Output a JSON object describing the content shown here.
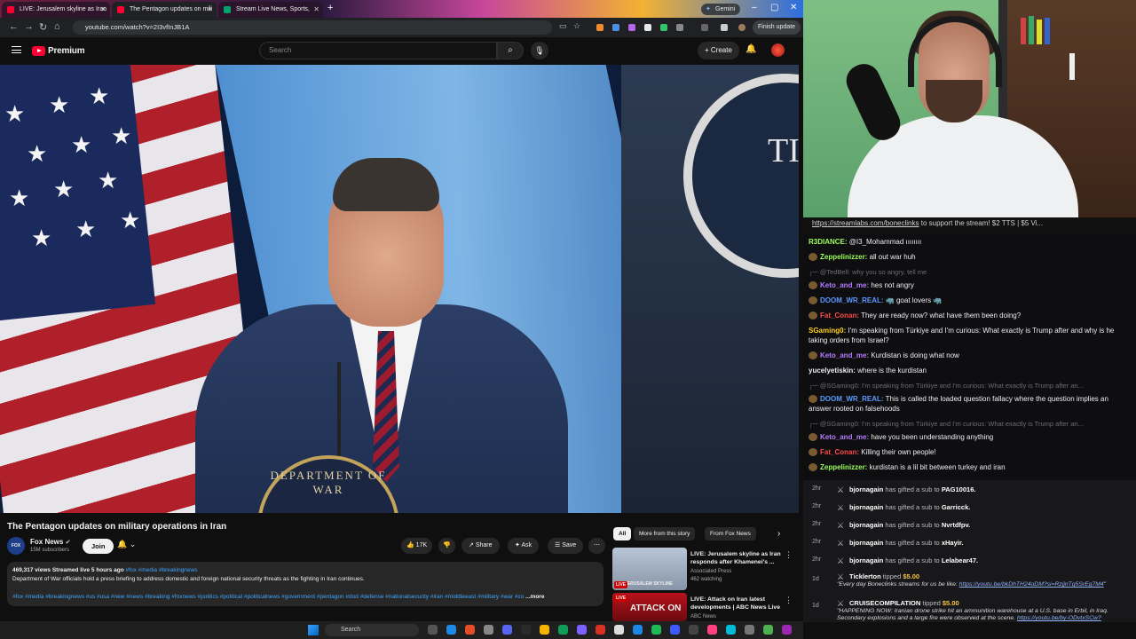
{
  "browser": {
    "tabs": [
      {
        "label": "LIVE: Jerusalem skyline as Iran",
        "active": false
      },
      {
        "label": "The Pentagon updates on mili",
        "active": true
      },
      {
        "label": "Stream Live News, Sports,",
        "active": false
      }
    ],
    "gemini_label": "Gemini",
    "url": "youtube.com/watch?v=2I3vfInJB1A",
    "finish_update": "Finish update"
  },
  "youtube": {
    "logo_text": "Premium",
    "search_placeholder": "Search",
    "create_label": "Create"
  },
  "video": {
    "podium_text": "DEPARTMENT OF WAR",
    "wall_letter": "TI",
    "title": "The Pentagon updates on military operations in Iran"
  },
  "channel": {
    "name": "Fox News",
    "subscribers": "15M subscribers",
    "join_label": "Join"
  },
  "actions": {
    "likes": "17K",
    "share": "Share",
    "ask": "Ask",
    "save": "Save"
  },
  "description": {
    "meta": "469,317 views  Streamed live 5 hours ago",
    "meta_tags": "#fox #media #breakingnews",
    "text": "Department of War officials hold a press briefing to address domestic and foreign national security threats as the fighting in Iran continues.",
    "tags": "#fox #media #breakingnews #us #usa #new #news #breaking #foxnews #politics #political #politicalnews #government #pentagon #dod #defense #nationalsecurity #iran #middleeast #military #war #co",
    "more": "...more"
  },
  "related": {
    "chips": [
      "All",
      "More from this story",
      "From Fox News"
    ],
    "items": [
      {
        "title": "LIVE: Jerusalem skyline as Iran responds after Khamenei's ...",
        "channel": "Associated Press",
        "meta": "462 watching",
        "thumb_text": "JERUSALEM SKYLINE",
        "badge": "LIVE"
      },
      {
        "title": "LIVE: Attack on Iran latest developments | ABC News Live",
        "channel": "ABC News",
        "meta": "",
        "thumb_text": "ATTACK ON",
        "badge": "LIVE"
      }
    ]
  },
  "stream": {
    "banner_link": "https://streamlabs.com/boneclinks",
    "banner_rest": " to support the stream! $2 TTS | $5 Vi..."
  },
  "chat": [
    {
      "user": "R3DIANCE:",
      "color": "#9cff5c",
      "text": " @I3_Mohammad ıııııııı",
      "badge": false,
      "reply": false
    },
    {
      "user": "Zeppelinizzer:",
      "color": "#9cff5c",
      "text": " all out war huh",
      "badge": true,
      "reply": false
    },
    {
      "user": "",
      "color": "#6d6d72",
      "text": "@TedBell: why you so angry, tell me",
      "badge": false,
      "reply": true
    },
    {
      "user": "Keto_and_me:",
      "color": "#b57bff",
      "text": " hes not angry",
      "badge": true,
      "reply": false
    },
    {
      "user": "DOOM_WR_REAL:",
      "color": "#5b9bff",
      "text": " 🦏 goat lovers 🦏",
      "badge": true,
      "reply": false
    },
    {
      "user": "Fat_Conan:",
      "color": "#ff4a4a",
      "text": " They are ready now? what have them been doing?",
      "badge": true,
      "reply": false
    },
    {
      "user": "SGaming0:",
      "color": "#ffd21f",
      "text": " I'm speaking from Türkiye and I'm curious: What exactly is Trump after and why is he taking orders from Israel?",
      "badge": false,
      "reply": false
    },
    {
      "user": "Keto_and_me:",
      "color": "#b57bff",
      "text": " Kurdistan is doing what now",
      "badge": true,
      "reply": false
    },
    {
      "user": "yucelyetiskin:",
      "color": "#efeff1",
      "text": " where is the kurdistan",
      "badge": false,
      "reply": false
    },
    {
      "user": "",
      "color": "#6d6d72",
      "text": "@SGaming0: I'm speaking from Türkiye and I'm curious: What exactly is Trump after an...",
      "badge": false,
      "reply": true
    },
    {
      "user": "DOOM_WR_REAL:",
      "color": "#5b9bff",
      "text": " This is called the loaded question fallacy where the question implies an answer rooted on falsehoods",
      "badge": true,
      "reply": false
    },
    {
      "user": "",
      "color": "#6d6d72",
      "text": "@SGaming0: I'm speaking from Türkiye and I'm curious: What exactly is Trump after an...",
      "badge": false,
      "reply": true
    },
    {
      "user": "Keto_and_me:",
      "color": "#b57bff",
      "text": " have you been understanding anything",
      "badge": true,
      "reply": false
    },
    {
      "user": "Fat_Conan:",
      "color": "#ff4a4a",
      "text": " Killing their own people!",
      "badge": true,
      "reply": false
    },
    {
      "user": "Zeppelinizzer:",
      "color": "#9cff5c",
      "text": " kurdistan is a lil bit between turkey and iran",
      "badge": true,
      "reply": false
    }
  ],
  "events": [
    {
      "time": "2hr",
      "user": "bjornagain",
      "action": " has gifted a sub to ",
      "target": "PAG10016."
    },
    {
      "time": "2hr",
      "user": "bjornagain",
      "action": " has gifted a sub to ",
      "target": "Garricck."
    },
    {
      "time": "2hr",
      "user": "bjornagain",
      "action": " has gifted a sub to ",
      "target": "Nvrtdfpv."
    },
    {
      "time": "2hr",
      "user": "bjornagain",
      "action": " has gifted a sub to ",
      "target": "xHayir."
    },
    {
      "time": "2hr",
      "user": "bjornagain",
      "action": " has gifted a sub to ",
      "target": "Lelabear47."
    }
  ],
  "tips": [
    {
      "time": "1d",
      "user": "Ticklerton",
      "action": " tipped ",
      "amount": "$5.00",
      "message": "\"Every day Boneclinks streams for us be like: ",
      "link": "https://youtu.be/bkDhTH24oDM?si=RzjjnTg5SrEg7M4",
      "end": "\""
    },
    {
      "time": "1d",
      "user": "CRUISECOMPILATION",
      "action": " tipped ",
      "amount": "$5.00",
      "message": "\"HAPPENING NOW: Iranian drone strike hit an ammunition warehouse at a U.S. base in Erbil, in Iraq. Secondary explosions and a large fire were observed at the scene. ",
      "link": "https://youtu.be/by-ODvtxSCw?si=Rps_wr_u05g0SbtG",
      "end": "\""
    }
  ],
  "taskbar": {
    "search": "Search"
  }
}
